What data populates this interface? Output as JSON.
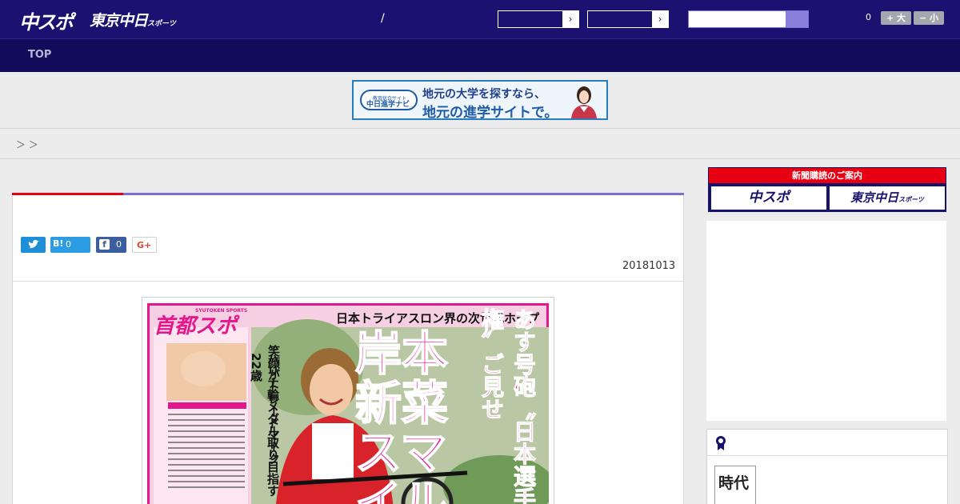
{
  "header": {
    "logo_main": "中スポ",
    "logo_tokyo": "東京中日",
    "logo_tokyo_suffix": "スポーツ",
    "separator": "/",
    "select_arrow": "›",
    "font_count": "0",
    "font_larger": "+ 大",
    "font_smaller": "− 小",
    "colors": {
      "header_bg": "#1a1170",
      "nav_bg": "#110b5a",
      "accent_red": "#e60012"
    }
  },
  "nav": {
    "items": [
      {
        "label": "TOP"
      }
    ]
  },
  "banner": {
    "logo_caption": "教育総合サイト",
    "logo_text": "中日進学ナビ",
    "line1": "地元の大学を探すなら、",
    "line2": "地元の進学サイトで。"
  },
  "breadcrumb": {
    "text": "＞ ＞"
  },
  "article": {
    "share": {
      "tweet_icon": "twitter-bird",
      "hatena_label": "B!",
      "hatena_count": "0",
      "facebook_count": "0",
      "gplus_label": "G+"
    },
    "date": "20181013",
    "image": {
      "masthead": "首都スポ",
      "masthead_en": "SYUTOKEN SPORTS",
      "kicker": "日本トライアスロン界の次世代ホープ",
      "headline": "岸本新菜スマイル",
      "subhead": "あす号砲〝日本選手権〟ご見せ",
      "vertical_line1": "笑顔がトレードマーク",
      "vertical_line2": "ハリナ輪メダル取り目指す22歳"
    }
  },
  "sidebar": {
    "subscribe_head": "新聞購読のご案内",
    "subscribe_left": "中スポ",
    "subscribe_right": "東京中日",
    "subscribe_right_suffix": "スポーツ",
    "thumb_text": "時代"
  }
}
